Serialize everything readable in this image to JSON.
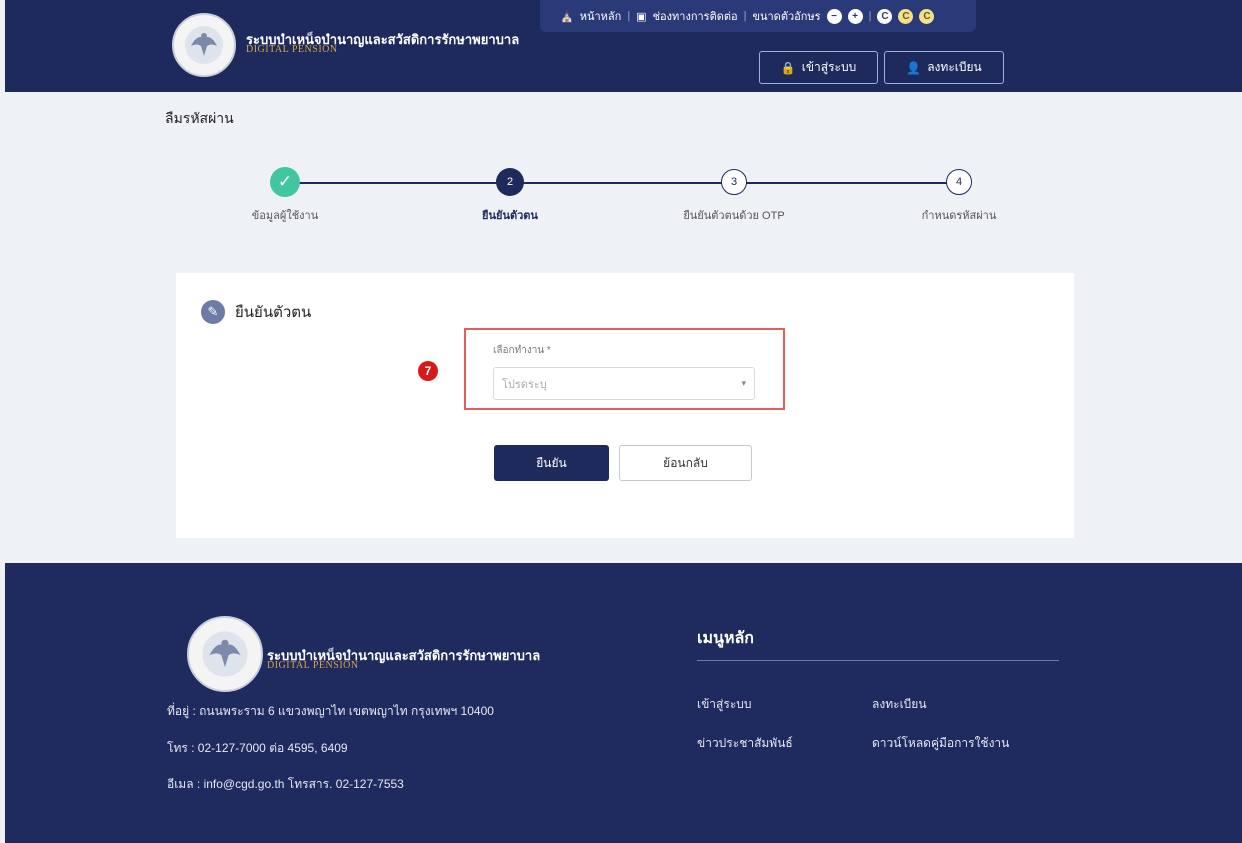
{
  "header": {
    "brand_th": "ระบบบำเหน็จบำนาญและสวัสดิการรักษาพยาบาล",
    "brand_en": "DIGITAL PENSION",
    "topbar": {
      "home": "หน้าหลัก",
      "contact": "ช่องทางการติดต่อ",
      "font_size_label": "ขนาดตัวอักษร",
      "decrease": "−",
      "increase": "+",
      "contrast": [
        "C",
        "C",
        "C"
      ]
    },
    "login_label": "เข้าสู่ระบบ",
    "register_label": "ลงทะเบียน"
  },
  "page": {
    "title": "ลืมรหัสผ่าน",
    "steps": [
      {
        "number": "✓",
        "label": "ข้อมูลผู้ใช้งาน",
        "state": "done"
      },
      {
        "number": "2",
        "label": "ยืนยันตัวตน",
        "state": "active"
      },
      {
        "number": "3",
        "label": "ยืนยันตัวตนด้วย OTP",
        "state": "todo"
      },
      {
        "number": "4",
        "label": "กำหนดรหัสผ่าน",
        "state": "todo"
      }
    ],
    "card_title": "ยืนยันตัวตน",
    "annotation": "7",
    "field_label": "เลือกทำงาน *",
    "field_placeholder": "โปรดระบุ",
    "confirm_label": "ยืนยัน",
    "back_label": "ย้อนกลับ"
  },
  "footer": {
    "brand_th": "ระบบบำเหน็จบำนาญและสวัสดิการรักษาพยาบาล",
    "brand_en": "DIGITAL PENSION",
    "address": "ที่อยู่ : ถนนพระราม 6 แขวงพญาไท เขตพญาไท กรุงเทพฯ 10400",
    "phone": "โทร : 02-127-7000 ต่อ 4595, 6409",
    "email": "อีเมล : info@cgd.go.th โทรสาร. 02-127-7553",
    "menu_title": "เมนูหลัก",
    "links": [
      "เข้าสู่ระบบ",
      "ลงทะเบียน",
      "ข่าวประชาสัมพันธ์",
      "ดาวน์โหลดคู่มือการใช้งาน"
    ]
  },
  "colors": {
    "navy": "#1e2a5c",
    "accent_green": "#41c6a0",
    "highlight_red": "#e65c5c",
    "gold": "#d4a54a"
  }
}
